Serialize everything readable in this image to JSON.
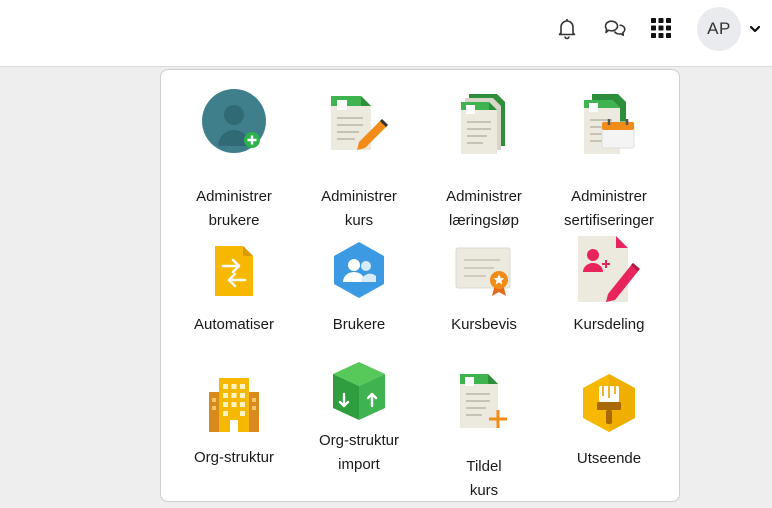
{
  "header": {
    "icons": [
      "bell-icon",
      "chat-icon",
      "app-grid-icon"
    ],
    "avatar_initials": "AP",
    "avatar_caret_icon": "chevron-down-icon"
  },
  "menu": {
    "items": [
      {
        "label": "Administrer brukere",
        "icon": "manage-users-icon"
      },
      {
        "label": "Administrer kurs",
        "icon": "manage-courses-icon"
      },
      {
        "label": "Administrer læringsløp",
        "icon": "manage-learning-paths-icon"
      },
      {
        "label": "Administrer sertifiseringer",
        "icon": "manage-certifications-icon"
      },
      {
        "label": "Automatiser",
        "icon": "automate-icon"
      },
      {
        "label": "Brukere",
        "icon": "users-icon"
      },
      {
        "label": "Kursbevis",
        "icon": "certificate-icon"
      },
      {
        "label": "Kursdeling",
        "icon": "course-sharing-icon"
      },
      {
        "label": "Org-struktur",
        "icon": "org-structure-icon"
      },
      {
        "label": "Org-struktur import",
        "icon": "org-structure-import-icon"
      },
      {
        "label": "Tildel kurs",
        "icon": "assign-course-icon"
      },
      {
        "label": "Utseende",
        "icon": "appearance-icon"
      }
    ]
  },
  "colors": {
    "green": "#3fb34f",
    "teal": "#3f7f8c",
    "orange": "#f28c18",
    "yellow": "#f6b800",
    "blue": "#3b9ae1",
    "pink": "#e8245c",
    "paper": "#eceadf"
  }
}
